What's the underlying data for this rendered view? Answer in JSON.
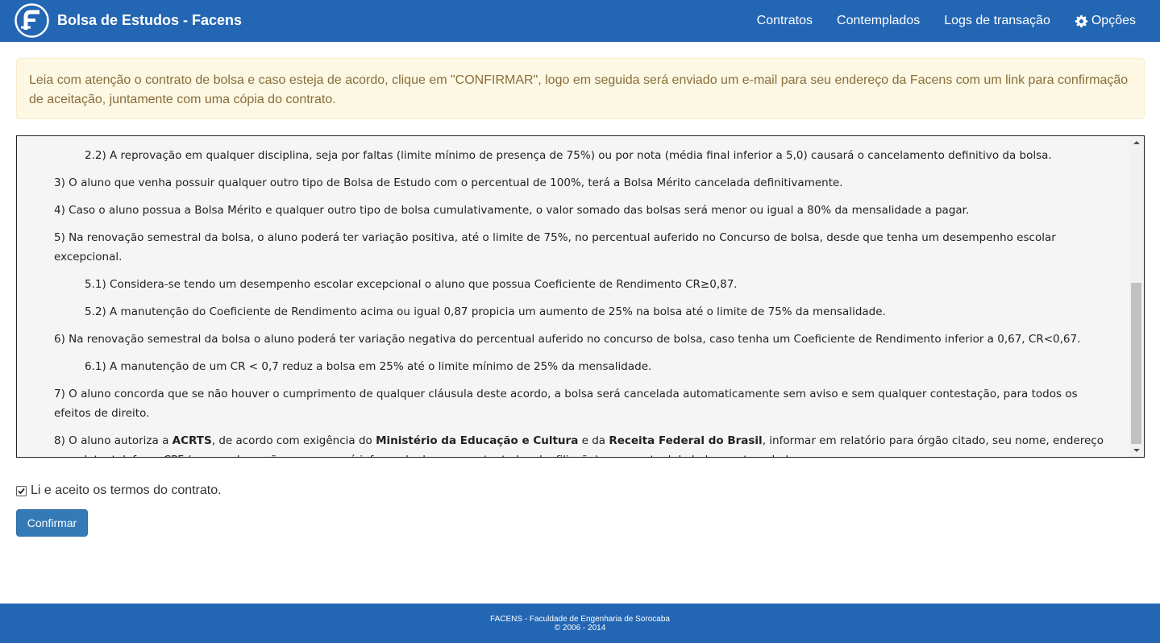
{
  "navbar": {
    "brand_title": "Bolsa de Estudos - Facens",
    "links": [
      "Contratos",
      "Contemplados",
      "Logs de transação"
    ],
    "options_label": "Opções"
  },
  "alert": {
    "text": "Leia com atenção o contrato de bolsa e caso esteja de acordo, clique em \"CONFIRMAR\", logo em seguida será enviado um e-mail para seu endereço da Facens com um link para confirmação de aceitação, juntamente com uma cópia do contrato."
  },
  "contract": {
    "c_2_2": "2.2) A reprovação em qualquer disciplina, seja por faltas (limite mínimo de presença de 75%) ou por nota (média final inferior a 5,0) causará o cancelamento definitivo da bolsa.",
    "c_3": "3) O aluno que venha possuir qualquer outro tipo de Bolsa de Estudo com o percentual de 100%, terá a Bolsa Mérito cancelada definitivamente.",
    "c_4": "4) Caso o aluno possua a Bolsa Mérito e qualquer outro tipo de bolsa cumulativamente, o valor somado das bolsas será menor ou igual a 80% da mensalidade a pagar.",
    "c_5": "5) Na renovação semestral da bolsa, o aluno poderá ter variação positiva, até o limite de 75%, no percentual auferido no Concurso de bolsa, desde que tenha um desempenho escolar excepcional.",
    "c_5_1": "5.1) Considera-se tendo um desempenho escolar excepcional o aluno que possua Coeficiente de Rendimento CR≥0,87.",
    "c_5_2": "5.2) A manutenção do Coeficiente de Rendimento acima ou igual 0,87 propicia um aumento de 25% na bolsa até o limite de 75% da mensalidade.",
    "c_6": "6) Na renovação semestral da bolsa o aluno poderá ter variação negativa do percentual auferido no concurso de bolsa, caso tenha um Coeficiente de Rendimento inferior a 0,67, CR<0,67.",
    "c_6_1": "6.1) A manutenção de um CR < 0,7 reduz a bolsa em 25% até o limite mínimo de 25% da mensalidade.",
    "c_7": "7) O aluno concorda que se não houver o cumprimento de qualquer cláusula deste acordo, a bolsa será cancelada automaticamente sem aviso e sem qualquer contestação, para todos os efeitos de direito.",
    "c_8": {
      "p1": "8) O aluno autoriza a ",
      "b1": "ACRTS",
      "p2": ", de acordo com exigência do ",
      "b2": "Ministério da Educação e Cultura",
      "p3": " e da ",
      "b3": "Receita Federal do Brasil",
      "p4": ", informar em relatório para órgão citado, seu nome, endereço completo, telefone, CPF (caso o aluno não possua, será informado do representante legal e filiação) e percentual de bolsa contemplado."
    }
  },
  "accept": {
    "label": "Li e aceito os termos do contrato.",
    "checked": true
  },
  "confirm_button": "Confirmar",
  "footer": {
    "line1": "FACENS - Faculdade de Engenharia de Sorocaba",
    "line2": "© 2006 - 2014"
  },
  "colors": {
    "navbar": "#2266b4",
    "alert_bg": "#fcf8e3",
    "alert_text": "#8a6d3b",
    "button": "#337ab7"
  },
  "icons": {
    "brand": "facens-logo",
    "options": "gear-icon",
    "accept": "checkmark-icon"
  }
}
